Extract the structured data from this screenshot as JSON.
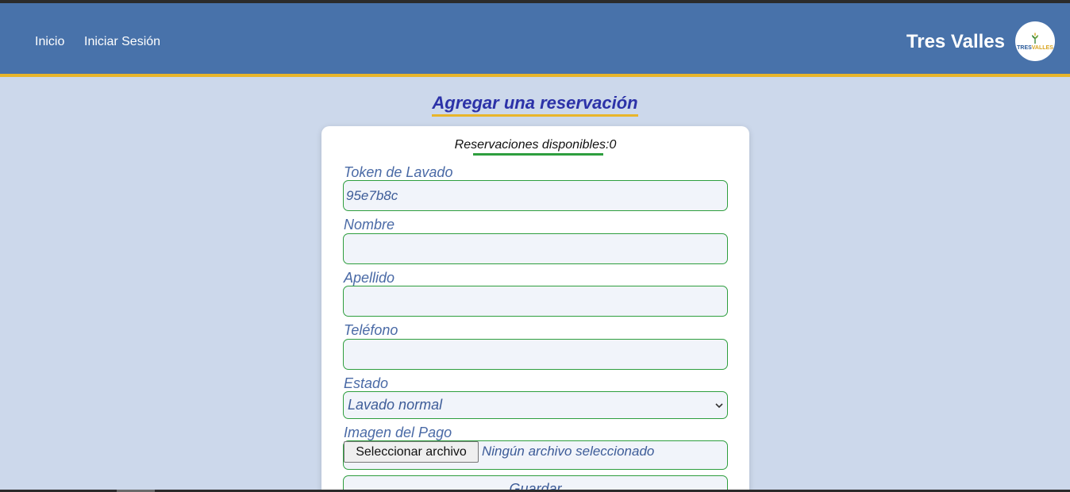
{
  "nav": {
    "links": [
      "Inicio",
      "Iniciar Sesión"
    ],
    "brand": "Tres Valles",
    "logo_text_a": "TRES",
    "logo_text_b": "VALLES"
  },
  "page": {
    "title": "Agregar una reservación"
  },
  "form": {
    "available_label": "Reservaciones disponibles:",
    "available_count": "0",
    "token_label": "Token de Lavado",
    "token_value": "95e7b8c",
    "name_label": "Nombre",
    "name_value": "",
    "lastname_label": "Apellido",
    "lastname_value": "",
    "phone_label": "Teléfono",
    "phone_value": "",
    "status_label": "Estado",
    "status_selected": "Lavado normal",
    "image_label": "Imagen del Pago",
    "file_button_label": "Seleccionar archivo",
    "file_status": "Ningún archivo seleccionado",
    "save_label": "Guardar"
  },
  "colors": {
    "navbar": "#4872aa",
    "accent": "#e8b52a",
    "input_border": "#2e9e3e",
    "title": "#2c32a8"
  }
}
